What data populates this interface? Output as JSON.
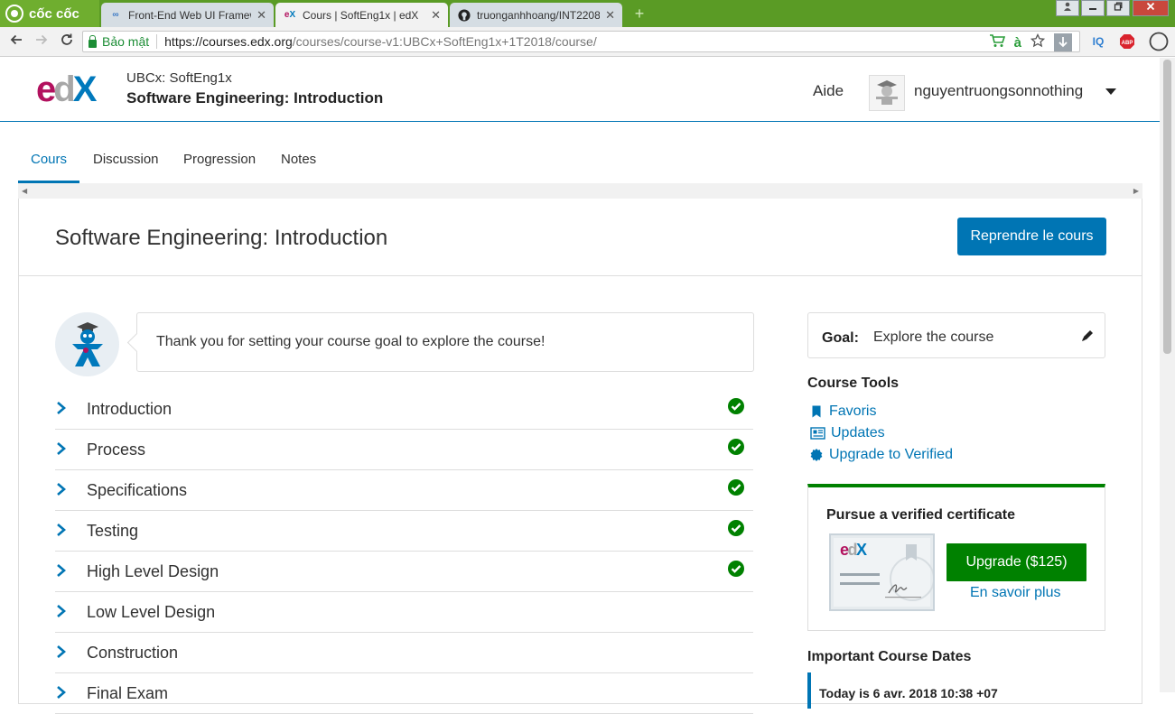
{
  "browser": {
    "brand": "cốc cốc",
    "tabs": [
      {
        "title": "Front-End Web UI Framew",
        "icon": "coursera-icon"
      },
      {
        "title": "Cours | SoftEng1x | edX",
        "icon": "edx-favicon",
        "active": true
      },
      {
        "title": "truonganhhoang/INT2208",
        "icon": "github-icon"
      }
    ],
    "close_glyph": "✕",
    "new_tab_glyph": "+",
    "secure_label": "Bảo mật",
    "url_host": "https://courses.edx.org",
    "url_path": "/courses/course-v1:UBCx+SoftEng1x+1T2018/course/",
    "ext_iq": "IQ",
    "ext_abp": "ABP"
  },
  "header": {
    "logo": {
      "e": "e",
      "d": "d",
      "x": "X"
    },
    "org": "UBCx: SoftEng1x",
    "course_name": "Software Engineering: Introduction",
    "help": "Aide",
    "username": "nguyentruongsonnothing"
  },
  "course_tabs": [
    "Cours",
    "Discussion",
    "Progression",
    "Notes"
  ],
  "main": {
    "title": "Software Engineering: Introduction",
    "resume_button": "Reprendre le cours",
    "goal_message": "Thank you for setting your course goal to explore the course!",
    "outline": [
      {
        "name": "Introduction",
        "completed": true
      },
      {
        "name": "Process",
        "completed": true
      },
      {
        "name": "Specifications",
        "completed": true
      },
      {
        "name": "Testing",
        "completed": true
      },
      {
        "name": "High Level Design",
        "completed": true
      },
      {
        "name": "Low Level Design",
        "completed": false
      },
      {
        "name": "Construction",
        "completed": false
      },
      {
        "name": "Final Exam",
        "completed": false
      }
    ]
  },
  "sidebar": {
    "goal_label": "Goal:",
    "goal_value": "Explore the course",
    "tools_title": "Course Tools",
    "tools": [
      {
        "label": "Favoris",
        "icon": "bookmark-icon"
      },
      {
        "label": "Updates",
        "icon": "newspaper-icon"
      },
      {
        "label": "Upgrade to Verified",
        "icon": "certificate-badge-icon"
      }
    ],
    "verified": {
      "title": "Pursue a verified certificate",
      "upgrade_button": "Upgrade ($125)",
      "learn_more": "En savoir plus"
    },
    "dates_title": "Important Course Dates",
    "dates_today": "Today is 6 avr. 2018 10:38 +07"
  },
  "colors": {
    "brand_blue": "#0075b4",
    "success_green": "#008100",
    "edx_magenta": "#b2115e",
    "browser_green": "#5a9b25"
  }
}
